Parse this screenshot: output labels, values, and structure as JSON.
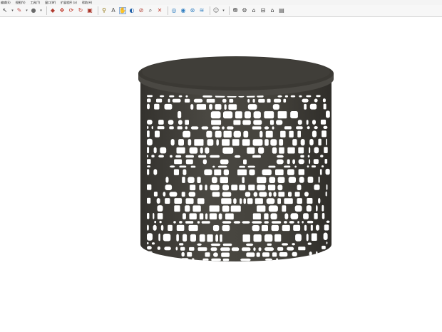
{
  "menus": [
    "编辑(E)",
    "视图(V)",
    "工具(T)",
    "窗口(W)",
    "扩展程序 (x)",
    "帮助(H)"
  ],
  "toolbar_icons": [
    "select-arrow-icon",
    "dropdown-arrow-icon",
    "eraser-icon",
    "dropdown-arrow-icon",
    "paint-bucket-icon",
    "dropdown-arrow-icon",
    "push-pull-icon",
    "move-icon",
    "rotate-icon",
    "follow-me-icon",
    "scale-icon",
    "tape-measure-icon",
    "text-icon",
    "orbit-icon",
    "pan-icon",
    "zoom-icon",
    "zoom-extents-icon",
    "component-icon",
    "solid-tools-icon",
    "outer-shell-icon",
    "intersect-icon",
    "style-icon",
    "dropdown-arrow-icon",
    "warehouse-icon",
    "extension-icon",
    "house-icon",
    "section-icon",
    "home-icon",
    "layout-icon"
  ],
  "colors": {
    "model_dark": "#3f3d38",
    "model_top": "#3a3833",
    "model_rim": "#56534c",
    "background": "#ffffff",
    "toolbar": "#f7f7f7"
  }
}
